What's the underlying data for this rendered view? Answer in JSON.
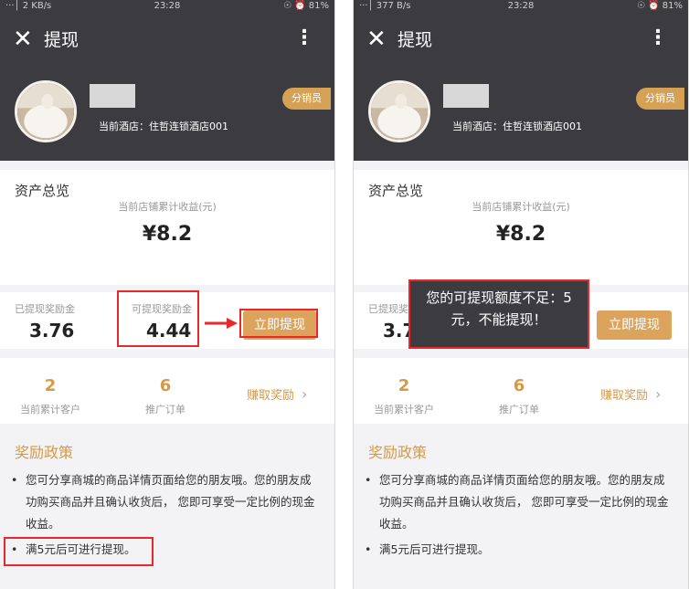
{
  "screens": [
    {
      "status": {
        "left": " ‧‧‧│ 2 KB/s",
        "time": "23:28",
        "right": "☉ ⏰ 81%"
      },
      "header": {
        "close_icon": "✕",
        "title": "提现",
        "more_icon": "⋮"
      },
      "profile": {
        "hotel": "当前酒店：住哲连锁酒店001",
        "badge": "分销员"
      },
      "overview": {
        "title": "资产总览",
        "subtitle": "当前店铺累计收益(元)",
        "amount": "¥8.2"
      },
      "funds": {
        "withdrawn_label": "已提现奖励金",
        "withdrawn_value": "3.76",
        "available_label": "可提现奖励金",
        "available_value": "4.44",
        "withdraw_button": "立即提现"
      },
      "stats": {
        "customers_value": "2",
        "customers_label": "当前累计客户",
        "orders_value": "6",
        "orders_label": "推广订单",
        "earn_label": "赚取奖励",
        "chevron": "›"
      },
      "policy": {
        "title": "奖励政策",
        "bullet": "•",
        "item1": "您可分享商城的商品详情页面给您的朋友哦。您的朋友成功购买商品并且确认收货后， 您即可享受一定比例的现金收益。",
        "item2": "满5元后可进行提现。"
      }
    },
    {
      "status": {
        "left": " ‧‧‧│ 377 B/s",
        "time": "23:28",
        "right": "☉ ⏰ 81%"
      },
      "header": {
        "close_icon": "✕",
        "title": "提现",
        "more_icon": "⋮"
      },
      "profile": {
        "hotel": "当前酒店：住哲连锁酒店001",
        "badge": "分销员"
      },
      "overview": {
        "title": "资产总览",
        "subtitle": "当前店铺累计收益(元)",
        "amount": "¥8.2"
      },
      "funds": {
        "withdrawn_label": "已提现奖励金",
        "withdrawn_value": "3.76",
        "withdraw_button": "立即提现"
      },
      "stats": {
        "customers_value": "2",
        "customers_label": "当前累计客户",
        "orders_value": "6",
        "orders_label": "推广订单",
        "earn_label": "赚取奖励",
        "chevron": "›"
      },
      "policy": {
        "title": "奖励政策",
        "bullet": "•",
        "item1": "您可分享商城的商品详情页面给您的朋友哦。您的朋友成功购买商品并且确认收货后， 您即可享受一定比例的现金收益。",
        "item2": "满5元后可进行提现。"
      },
      "toast": {
        "line1": "您的可提现额度不足：5",
        "line2": "元，不能提现！"
      }
    }
  ],
  "colors": {
    "header_bg": "#3c3b40",
    "accent": "#d59a45",
    "button": "#dca35c",
    "highlight": "#e8282b"
  }
}
